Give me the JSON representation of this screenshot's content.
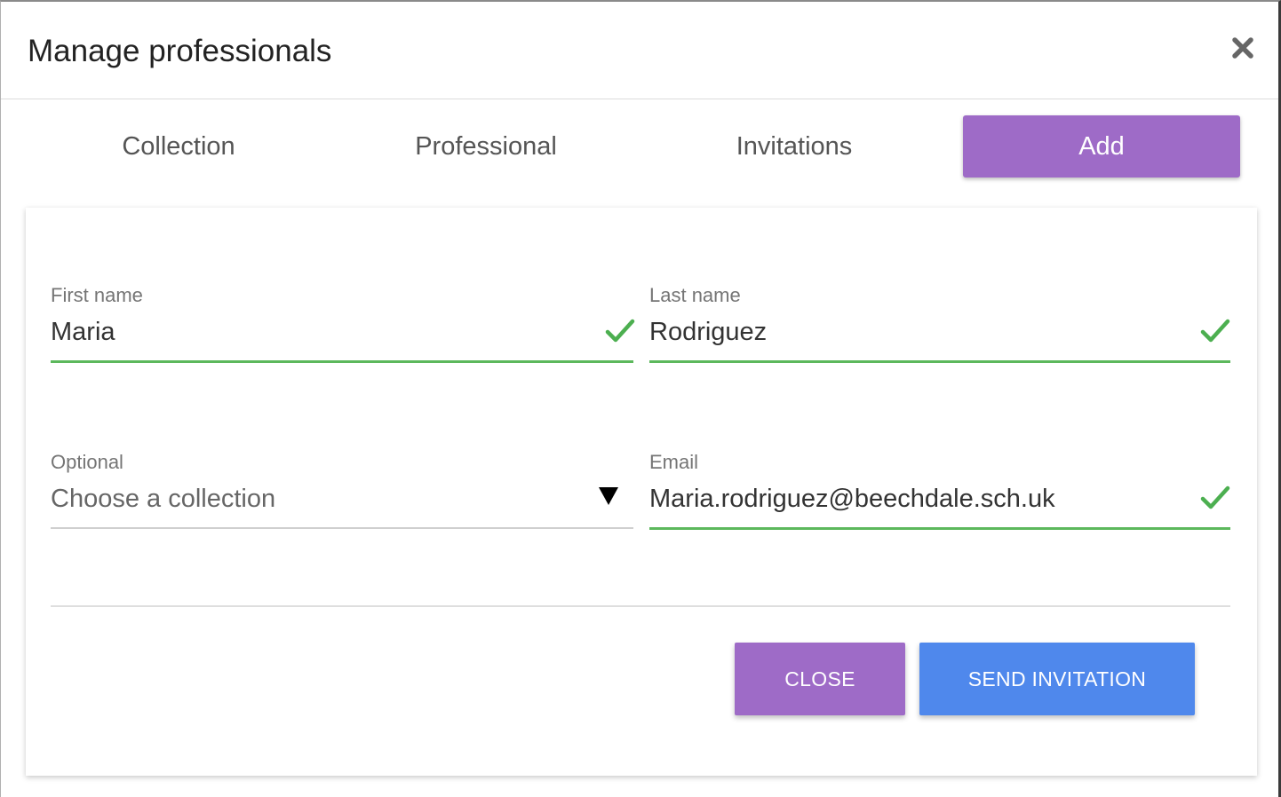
{
  "modal": {
    "title": "Manage professionals",
    "close_icon": "close-icon"
  },
  "tabs": [
    {
      "label": "Collection",
      "active": false
    },
    {
      "label": "Professional",
      "active": false
    },
    {
      "label": "Invitations",
      "active": false
    },
    {
      "label": "Add",
      "active": true
    }
  ],
  "form": {
    "first_name": {
      "label": "First name",
      "value": "Maria",
      "valid": true
    },
    "last_name": {
      "label": "Last name",
      "value": "Rodriguez",
      "valid": true
    },
    "collection": {
      "label": "Optional",
      "placeholder": "Choose a collection"
    },
    "email": {
      "label": "Email",
      "value": "Maria.rodriguez@beechdale.sch.uk",
      "valid": true
    }
  },
  "buttons": {
    "close_label": "CLOSE",
    "send_label": "SEND INVITATION"
  },
  "colors": {
    "accent_purple": "#9e6bc7",
    "primary_blue": "#4f88ec",
    "valid_green": "#5cb85c"
  }
}
